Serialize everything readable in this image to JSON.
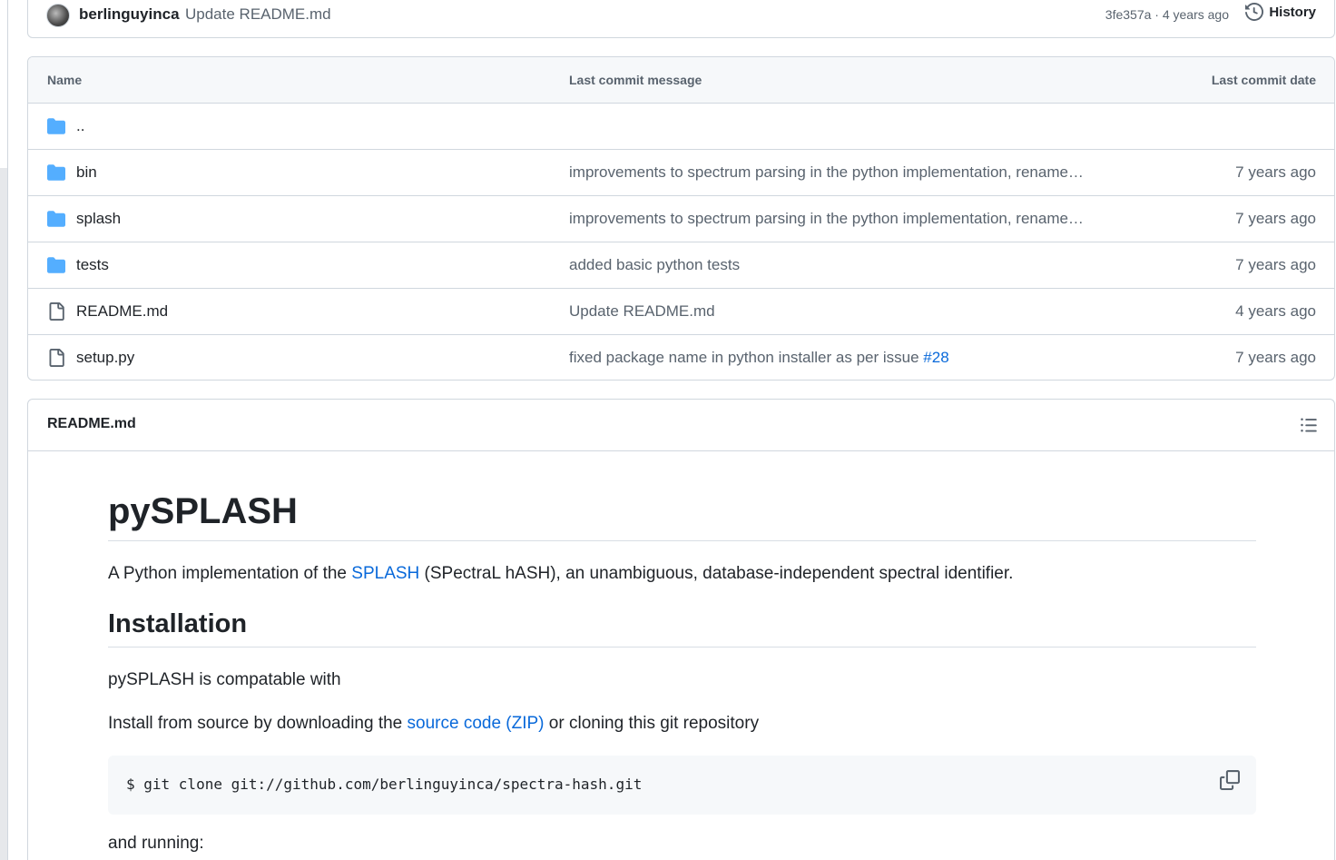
{
  "commit": {
    "author": "berlinguyinca",
    "message": "Update README.md",
    "sha_time": "3fe357a · 4 years ago",
    "history_label": "History"
  },
  "table": {
    "headers": {
      "name": "Name",
      "message": "Last commit message",
      "date": "Last commit date"
    },
    "rows": [
      {
        "name": "..",
        "type": "folder",
        "message": "",
        "date": ""
      },
      {
        "name": "bin",
        "type": "folder",
        "message": "improvements to spectrum parsing in the python implementation, rename…",
        "date": "7 years ago"
      },
      {
        "name": "splash",
        "type": "folder",
        "message": "improvements to spectrum parsing in the python implementation, rename…",
        "date": "7 years ago"
      },
      {
        "name": "tests",
        "type": "folder",
        "message": "added basic python tests",
        "date": "7 years ago"
      },
      {
        "name": "README.md",
        "type": "file",
        "message": "Update README.md",
        "date": "4 years ago"
      },
      {
        "name": "setup.py",
        "type": "file",
        "message": "fixed package name in python installer as per issue ",
        "link": "#28",
        "date": "7 years ago"
      }
    ]
  },
  "readme": {
    "title": "README.md",
    "h1": "pySPLASH",
    "intro_before": "A Python implementation of the ",
    "intro_link": "SPLASH",
    "intro_after": " (SPectraL hASH), an unambiguous, database-independent spectral identifier.",
    "h2": "Installation",
    "compat": "pySPLASH is compatable with",
    "install_before": "Install from source by downloading the ",
    "install_link": "source code (ZIP)",
    "install_after": " or cloning this git repository",
    "code": "$ git clone git://github.com/berlinguyinca/spectra-hash.git",
    "trailing": "and running:"
  },
  "colors": {
    "folder": "#54aeff",
    "link": "#0969da",
    "muted": "#59636e",
    "border": "#d0d7de"
  },
  "icons": [
    "history-icon",
    "folder-icon",
    "file-icon",
    "outline-icon",
    "copy-icon"
  ]
}
